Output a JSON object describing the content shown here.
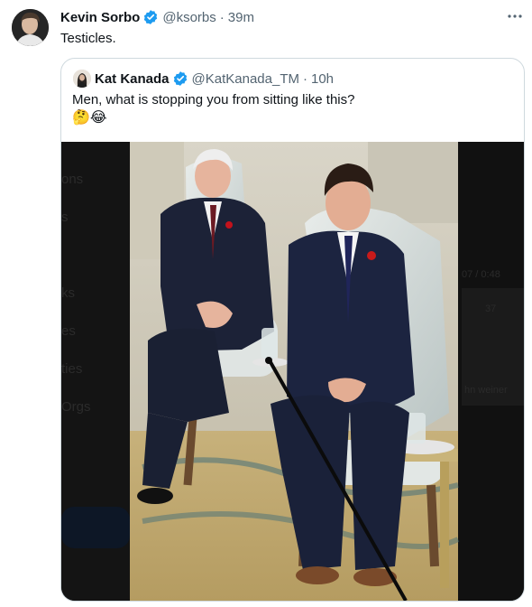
{
  "tweet": {
    "display_name": "Kevin Sorbo",
    "handle": "@ksorbs",
    "separator": "·",
    "time": "39m",
    "text": "Testicles.",
    "more_icon": "more-horizontal-icon",
    "verified_color": "#1d9bf0"
  },
  "quoted_tweet": {
    "display_name": "Kat Kanada",
    "handle": "@KatKanada_TM",
    "separator": "·",
    "time": "10h",
    "text": "Men, what is stopping you from sitting like this?",
    "emojis": "🤔😂"
  },
  "media_ghost_text": {
    "left": [
      "ons",
      "s",
      "ks",
      "es",
      "ties",
      "Orgs"
    ],
    "right": [
      "07 / 0:48",
      "37",
      "hn weiner"
    ]
  }
}
